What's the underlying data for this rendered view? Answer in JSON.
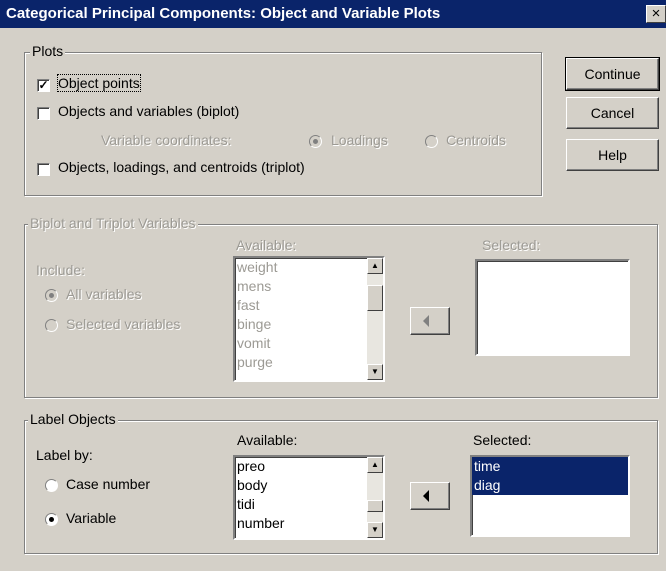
{
  "window": {
    "title": "Categorical Principal Components: Object and Variable Plots",
    "close_glyph": "×"
  },
  "plots": {
    "legend": "Plots",
    "object_points": {
      "label": "Object points",
      "checked": true
    },
    "biplot": {
      "label": "Objects and variables (biplot)",
      "checked": false
    },
    "variable_coordinates": {
      "label": "Variable coordinates:",
      "loadings": "Loadings",
      "centroids": "Centroids",
      "selected": "Loadings"
    },
    "triplot": {
      "label": "Objects, loadings, and centroids (triplot)",
      "checked": false
    }
  },
  "buttons": {
    "continue": "Continue",
    "cancel": "Cancel",
    "help": "Help"
  },
  "biplot_vars": {
    "legend": "Biplot and Triplot Variables",
    "include_label": "Include:",
    "all_variables": "All variables",
    "selected_variables": "Selected variables",
    "include_selected": "All variables",
    "available_label": "Available:",
    "available": [
      "weight",
      "mens",
      "fast",
      "binge",
      "vomit",
      "purge"
    ],
    "selected_label": "Selected:",
    "selected": []
  },
  "label_objects": {
    "legend": "Label Objects",
    "label_by": "Label by:",
    "case_number": "Case number",
    "variable": "Variable",
    "label_by_selected": "Variable",
    "available_label": "Available:",
    "available": [
      "preo",
      "body",
      "tidi",
      "number"
    ],
    "selected_label": "Selected:",
    "selected": [
      "time",
      "diag"
    ]
  },
  "colors": {
    "titlebar": "#0a246a",
    "face": "#d4d0c8",
    "selection": "#0a246a"
  }
}
